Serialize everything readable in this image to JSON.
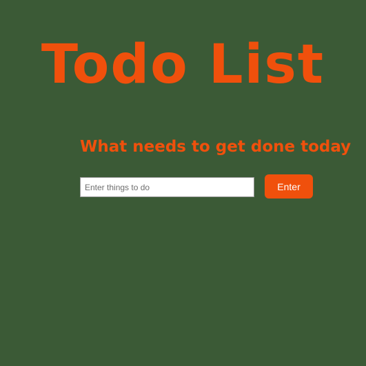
{
  "app": {
    "title": "Todo List",
    "subtitle": "What needs to get done today"
  },
  "form": {
    "input_value": "",
    "input_placeholder": "Enter things to do",
    "submit_label": "Enter"
  },
  "colors": {
    "background": "#3b5a36",
    "accent": "#f0500c",
    "button_text": "#ffffff",
    "input_background": "#ffffff"
  }
}
